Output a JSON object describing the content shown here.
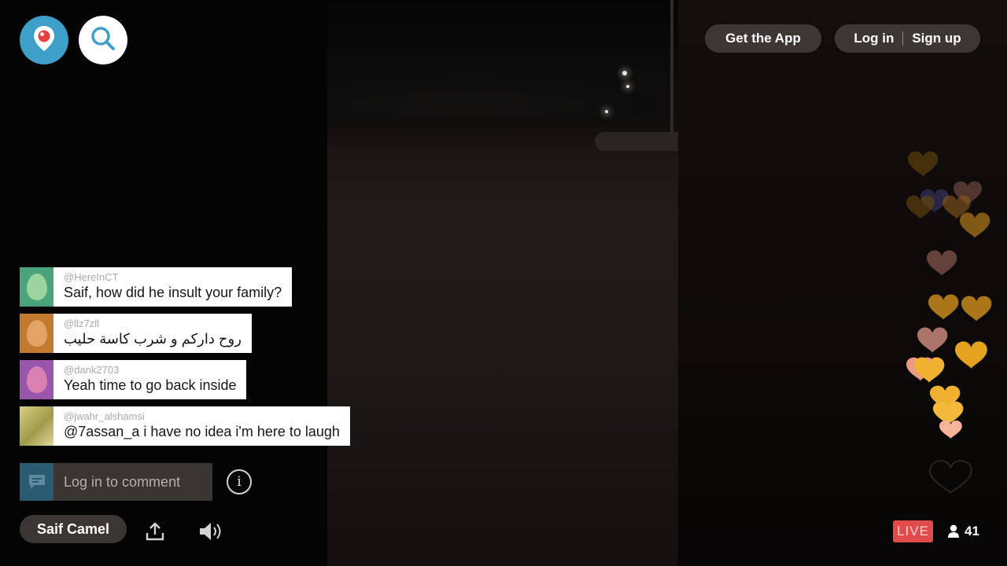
{
  "header": {
    "get_app_label": "Get the App",
    "login_label": "Log in",
    "signup_label": "Sign up"
  },
  "icons": {
    "logo": "periscope-pin-icon",
    "search": "search-icon",
    "comment": "comment-bubble-icon",
    "info": "info-icon",
    "share": "share-icon",
    "sound": "speaker-icon",
    "viewers": "person-icon",
    "hearts": "heart-icon"
  },
  "comments": [
    {
      "username": "@HereInCT",
      "message": "Saif, how did he insult your family?",
      "avatar_color": "#4aa37b",
      "egg_color": "#b8e4a8"
    },
    {
      "username": "@llz7zll",
      "message": "روح داركم و شرب كاسة حليب",
      "avatar_color": "#c47a2e",
      "egg_color": "#eeb27a"
    },
    {
      "username": "@dank2703",
      "message": "Yeah time to go back inside",
      "avatar_color": "#9a56ac",
      "egg_color": "#f08fb6"
    },
    {
      "username": "@jwahr_alshamsi",
      "message": "@7assan_a i have no idea i'm here to laugh",
      "avatar_color": "#bfb55a",
      "egg_color": "#d7cf86"
    }
  ],
  "comment_input": {
    "placeholder": "Log in to comment",
    "info_symbol": "i"
  },
  "footer": {
    "broadcaster_name": "Saif Camel",
    "live_label": "LIVE",
    "viewer_count": "41"
  },
  "colors": {
    "brand_blue": "#3e9fc9",
    "live_red": "#e24b4b",
    "pill_bg": "#463e3c"
  }
}
